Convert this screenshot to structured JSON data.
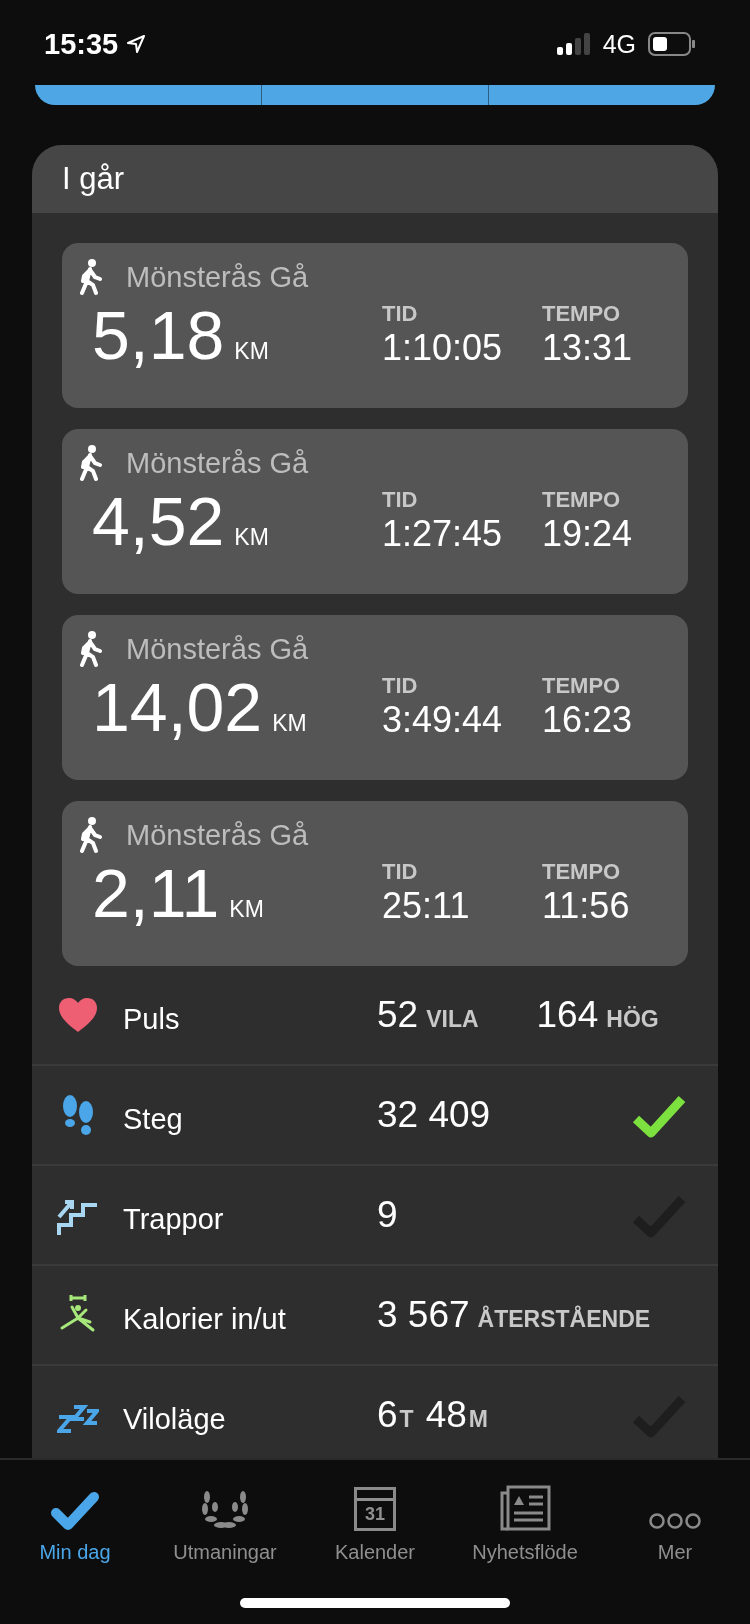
{
  "status_bar": {
    "time": "15:35",
    "network": "4G"
  },
  "day_card": {
    "title": "I går",
    "activities": [
      {
        "name": "Mönsterås Gå",
        "distance": "5,18",
        "distance_unit": "KM",
        "time_label": "TID",
        "time": "1:10:05",
        "pace_label": "TEMPO",
        "pace": "13:31"
      },
      {
        "name": "Mönsterås Gå",
        "distance": "4,52",
        "distance_unit": "KM",
        "time_label": "TID",
        "time": "1:27:45",
        "pace_label": "TEMPO",
        "pace": "19:24"
      },
      {
        "name": "Mönsterås Gå",
        "distance": "14,02",
        "distance_unit": "KM",
        "time_label": "TID",
        "time": "3:49:44",
        "pace_label": "TEMPO",
        "pace": "16:23"
      },
      {
        "name": "Mönsterås Gå",
        "distance": "2,11",
        "distance_unit": "KM",
        "time_label": "TID",
        "time": "25:11",
        "pace_label": "TEMPO",
        "pace": "11:56"
      }
    ],
    "metrics": [
      {
        "label": "Puls",
        "values": [
          {
            "value": "52",
            "unit": "VILA"
          },
          {
            "value": "164",
            "unit": "HÖG"
          }
        ]
      },
      {
        "label": "Steg",
        "values": [
          {
            "value": "32 409"
          }
        ],
        "checked": true
      },
      {
        "label": "Trappor",
        "values": [
          {
            "value": "9"
          }
        ],
        "checked": false
      },
      {
        "label": "Kalorier in/ut",
        "values": [
          {
            "value": "3 567",
            "unit": "ÅTERSTÅENDE"
          }
        ]
      },
      {
        "label": "Viloläge",
        "values": [
          {
            "value": "6",
            "unit": "T"
          },
          {
            "value": "48",
            "unit": "M"
          }
        ],
        "checked": false
      }
    ]
  },
  "tab_bar": [
    {
      "label": "Min dag",
      "selected": true
    },
    {
      "label": "Utmaningar",
      "selected": false
    },
    {
      "label": "Kalender",
      "selected": false,
      "calendar_day": "31"
    },
    {
      "label": "Nyhetsflöde",
      "selected": false
    },
    {
      "label": "Mer",
      "selected": false
    }
  ]
}
